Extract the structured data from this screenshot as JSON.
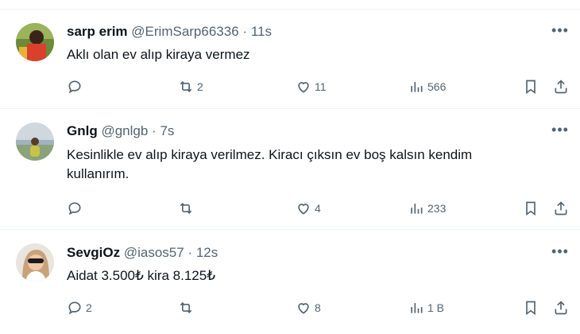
{
  "tweets": [
    {
      "name": "sarp erim",
      "handle": "@ErimSarp66336",
      "time": "11s",
      "text": "Aklı olan ev alıp kiraya vermez",
      "replies": "",
      "retweets": "2",
      "likes": "11",
      "views": "566"
    },
    {
      "name": "Gnlg",
      "handle": "@gnlgb",
      "time": "7s",
      "text": "Kesinlikle ev alıp kiraya verilmez. Kiracı çıksın ev boş kalsın kendim kullanırım.",
      "replies": "",
      "retweets": "",
      "likes": "4",
      "views": "233"
    },
    {
      "name": "SevgiOz",
      "handle": "@iasos57",
      "time": "12s",
      "text": "Aidat 3.500₺ kira 8.125₺",
      "replies": "2",
      "retweets": "",
      "likes": "8",
      "views": "1 B"
    }
  ],
  "ui": {
    "dot": "·",
    "more": "•••"
  },
  "icons": [
    "reply-icon",
    "retweet-icon",
    "like-icon",
    "views-icon",
    "bookmark-icon",
    "share-icon",
    "more-icon"
  ],
  "colors": {
    "text": "#0f1419",
    "muted": "#536471",
    "divider": "#eff3f4"
  }
}
